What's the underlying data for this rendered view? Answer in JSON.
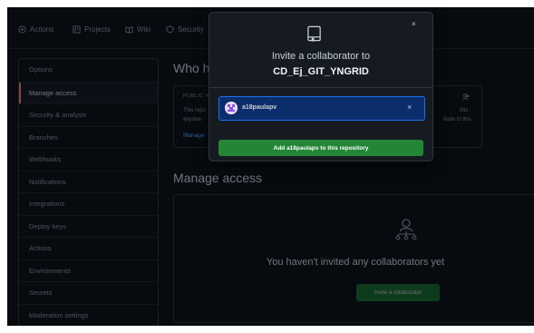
{
  "tabs": [
    {
      "label": "Actions",
      "icon": "play-icon"
    },
    {
      "label": "Projects",
      "icon": "project-icon"
    },
    {
      "label": "Wiki",
      "icon": "book-icon"
    },
    {
      "label": "Security",
      "icon": "shield-icon"
    }
  ],
  "sidebar": {
    "items": [
      {
        "label": "Options"
      },
      {
        "label": "Manage access"
      },
      {
        "label": "Security & analysis"
      },
      {
        "label": "Branches"
      },
      {
        "label": "Webhooks"
      },
      {
        "label": "Notifications"
      },
      {
        "label": "Integrations"
      },
      {
        "label": "Deploy keys"
      },
      {
        "label": "Actions"
      },
      {
        "label": "Environments"
      },
      {
        "label": "Secrets"
      },
      {
        "label": "Moderation settings"
      }
    ],
    "active_index": 1
  },
  "who": {
    "title": "Who h",
    "card_label": "PUBLIC R",
    "text_line1": "This repo",
    "text_line2": "anyone.",
    "right_line1": "this",
    "right_line2": "ibute to this",
    "link": "Manage"
  },
  "manage": {
    "title": "Manage access",
    "empty_text": "You haven't invited any collaborators yet",
    "invite_button": "Invite a collaborator"
  },
  "modal": {
    "close_symbol": "×",
    "title": "Invite a collaborator to",
    "repo": "CD_Ej_GIT_YNGRID",
    "selected_user": "a18paulapv",
    "clear_symbol": "×",
    "add_button": "Add a18paulapv to this repository"
  },
  "colors": {
    "background": "#0d1117",
    "accent_green": "#238636",
    "selection_blue": "#0c2d6b",
    "link_blue": "#58a6ff",
    "active_marker": "#f78166"
  }
}
